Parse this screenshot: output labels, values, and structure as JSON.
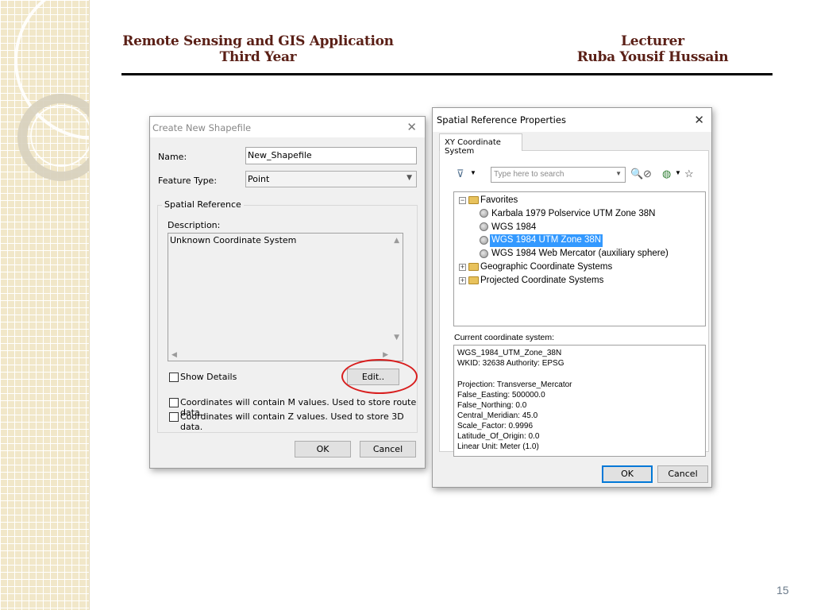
{
  "header": {
    "left_line1": "Remote Sensing and GIS Application",
    "left_line2": "Third Year",
    "right_line1": "Lecturer",
    "right_line2": "Ruba Yousif Hussain"
  },
  "page_number": "15",
  "create_shapefile": {
    "title": "Create New Shapefile",
    "name_label": "Name:",
    "name_value": "New_Shapefile",
    "feature_type_label": "Feature Type:",
    "feature_type_value": "Point",
    "spatial_reference_label": "Spatial Reference",
    "description_label": "Description:",
    "description_value": "Unknown Coordinate System",
    "show_details_label": "Show Details",
    "edit_button": "Edit..",
    "m_values_label": "Coordinates will contain M values. Used to store route data.",
    "z_values_label": "Coordinates will contain Z values. Used to store 3D data.",
    "ok_button": "OK",
    "cancel_button": "Cancel"
  },
  "spatial_reference": {
    "title": "Spatial Reference Properties",
    "tab_label": "XY Coordinate System",
    "search_placeholder": "Type here to search",
    "tree": {
      "favorites": "Favorites",
      "fav_items": [
        "Karbala 1979 Polservice UTM Zone 38N",
        "WGS 1984",
        "WGS 1984 UTM Zone 38N",
        "WGS 1984 Web Mercator (auxiliary sphere)"
      ],
      "geographic": "Geographic Coordinate Systems",
      "projected": "Projected Coordinate Systems"
    },
    "current_label": "Current coordinate system:",
    "current_lines": [
      "WGS_1984_UTM_Zone_38N",
      "WKID: 32638 Authority: EPSG",
      "Projection: Transverse_Mercator",
      "False_Easting: 500000.0",
      "False_Northing: 0.0",
      "Central_Meridian: 45.0",
      "Scale_Factor: 0.9996",
      "Latitude_Of_Origin: 0.0",
      "Linear Unit: Meter (1.0)"
    ],
    "ok_button": "OK",
    "cancel_button": "Cancel"
  },
  "colors": {
    "header_text": "#5a1f16",
    "highlight": "#d81e1e",
    "selection": "#3399ff"
  }
}
